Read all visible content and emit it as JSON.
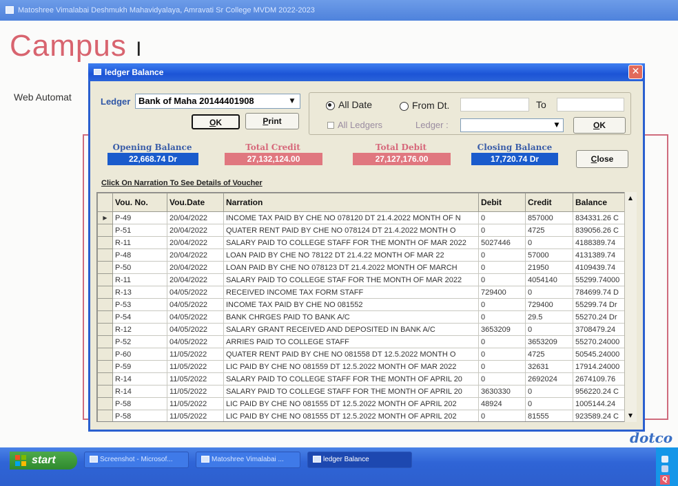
{
  "app": {
    "window_title": "Matoshree Vimalabai Deshmukh Mahavidyalaya, Amravati Sr College MVDM 2022-2023",
    "logo_text": "Campus",
    "logo_suffix": "I",
    "web_label": "Web Automat",
    "brand_fragment": "dotco"
  },
  "dialog": {
    "title": "ledger Balance",
    "close_glyph": "✕",
    "ledger_label": "Ledger",
    "ledger_value": "Bank of Maha 20144401908",
    "ok_label": "OK",
    "print_label": "Print",
    "all_date_label": "All Date",
    "from_dt_label": "From Dt.",
    "to_label": "To",
    "all_ledgers_label": "All Ledgers",
    "ledger2_label": "Ledger :",
    "ok2_label": "OK",
    "date_mode": "all_date",
    "summary": {
      "opening_label": "Opening Balance",
      "opening_value": "22,668.74 Dr",
      "credit_label": "Total Credit",
      "credit_value": "27,132,124.00",
      "debit_label": "Total Debit",
      "debit_value": "27,127,176.00",
      "closing_label": "Closing Balance",
      "closing_value": "17,720.74 Dr"
    },
    "close_label": "Close",
    "hint": "Click On Narration To See Details of Voucher",
    "columns": [
      "Vou. No.",
      "Vou.Date",
      "Narration",
      "Debit",
      "Credit",
      "Balance"
    ],
    "rows": [
      [
        "P-49",
        "20/04/2022",
        "INCOME TAX PAID BY CHE NO 078120 DT 21.4.2022 MONTH OF N",
        "0",
        "857000",
        "834331.26 C"
      ],
      [
        "P-51",
        "20/04/2022",
        "QUATER RENT PAID BY CHE NO 078124 DT 21.4.2022 MONTH O",
        "0",
        "4725",
        "839056.26 C"
      ],
      [
        "R-11",
        "20/04/2022",
        "SALARY PAID TO COLLEGE STAFF FOR THE MONTH OF MAR 2022",
        "5027446",
        "0",
        "4188389.74"
      ],
      [
        "P-48",
        "20/04/2022",
        "LOAN PAID BY CHE NO 78122 DT 21.4.22 MONTH OF MAR 22",
        "0",
        "57000",
        "4131389.74"
      ],
      [
        "P-50",
        "20/04/2022",
        "LOAN PAID BY CHE NO 078123 DT 21.4.2022 MONTH OF MARCH",
        "0",
        "21950",
        "4109439.74"
      ],
      [
        "R-11",
        "20/04/2022",
        "SALARY PAID TO COLLEGE STAF FOR THE MONTH OF MAR 2022",
        "0",
        "4054140",
        "55299.74000"
      ],
      [
        "R-13",
        "04/05/2022",
        "RECEIVED INCOME TAX FORM STAFF",
        "729400",
        "0",
        "784699.74 D"
      ],
      [
        "P-53",
        "04/05/2022",
        "INCOME TAX PAID BY CHE NO 081552",
        "0",
        "729400",
        "55299.74 Dr"
      ],
      [
        "P-54",
        "04/05/2022",
        "BANK CHRGES PAID TO BANK A/C",
        "0",
        "29.5",
        "55270.24 Dr"
      ],
      [
        "R-12",
        "04/05/2022",
        "SALARY GRANT RECEIVED AND DEPOSITED IN BANK A/C",
        "3653209",
        "0",
        "3708479.24"
      ],
      [
        "P-52",
        "04/05/2022",
        "ARRIES PAID TO COLLEGE STAFF",
        "0",
        "3653209",
        "55270.24000"
      ],
      [
        "P-60",
        "11/05/2022",
        "QUATER RENT PAID BY CHE NO 081558 DT 12.5.2022 MONTH O",
        "0",
        "4725",
        "50545.24000"
      ],
      [
        "P-59",
        "11/05/2022",
        "LIC PAID BY CHE NO 081559 DT 12.5.2022 MONTH OF MAR 2022",
        "0",
        "32631",
        "17914.24000"
      ],
      [
        "R-14",
        "11/05/2022",
        "SALARY PAID TO COLLEGE STAFF FOR THE MONTH OF APRIL 20",
        "0",
        "2692024",
        "2674109.76"
      ],
      [
        "R-14",
        "11/05/2022",
        "SALARY PAID TO COLLEGE STAFF FOR THE MONTH OF APRIL 20",
        "3630330",
        "0",
        "956220.24 C"
      ],
      [
        "P-58",
        "11/05/2022",
        "LIC PAID BY CHE NO 081555 DT 12.5.2022 MONTH OF APRIL 202",
        "48924",
        "0",
        "1005144.24"
      ],
      [
        "P-58",
        "11/05/2022",
        "LIC PAID BY CHE NO 081555 DT 12.5.2022 MONTH OF APRIL 202",
        "0",
        "81555",
        "923589.24 C"
      ]
    ],
    "selected_row_index": 0
  },
  "taskbar": {
    "start_label": "start",
    "tasks": [
      "Screenshot - Microsof...",
      "Matoshree Vimalabai ...",
      "ledger Balance"
    ],
    "active_task_index": 2,
    "tray_label": "Q"
  }
}
